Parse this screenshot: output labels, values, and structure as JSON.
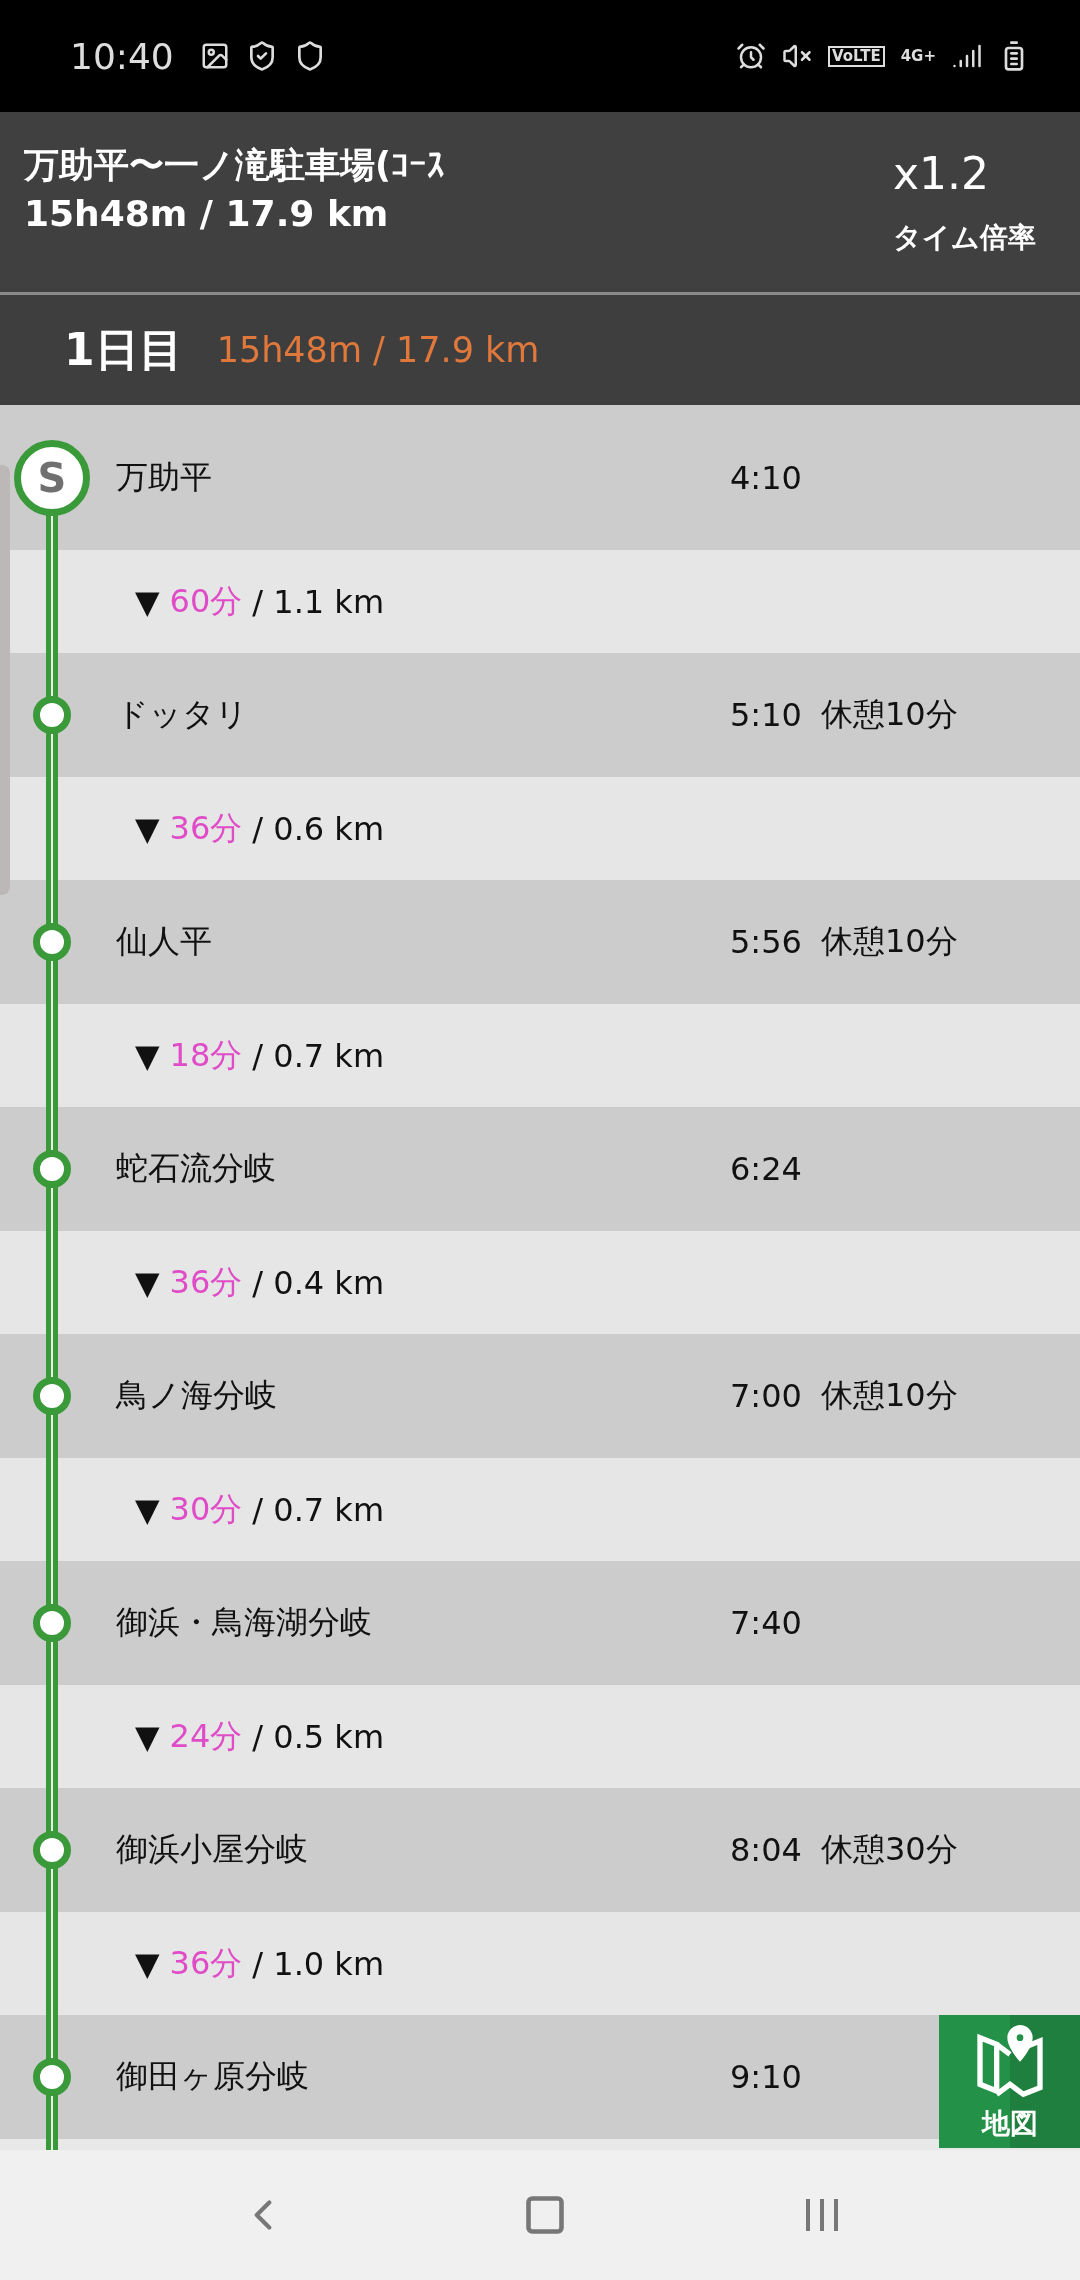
{
  "status_bar": {
    "time": "10:40",
    "volte": "VoLTE",
    "network": "4G+"
  },
  "header": {
    "title": "万助平〜一ノ滝駐車場(ｺｰｽ",
    "summary": "15h48m / 17.9 km",
    "multiplier": "x1.2",
    "multiplier_label": "タイム倍率"
  },
  "day": {
    "label": "1日目",
    "summary": "15h48m / 17.9 km"
  },
  "route": [
    {
      "kind": "start",
      "marker": "S",
      "name": "万助平",
      "time": "4:10"
    },
    {
      "kind": "segment",
      "arrow": "▼",
      "duration": "60分",
      "distance": "/ 1.1 km"
    },
    {
      "kind": "point",
      "name": "ドッタリ",
      "time": "5:10",
      "rest": "休憩10分"
    },
    {
      "kind": "segment",
      "arrow": "▼",
      "duration": "36分",
      "distance": "/ 0.6 km"
    },
    {
      "kind": "point",
      "name": "仙人平",
      "time": "5:56",
      "rest": "休憩10分"
    },
    {
      "kind": "segment",
      "arrow": "▼",
      "duration": "18分",
      "distance": "/ 0.7 km"
    },
    {
      "kind": "point",
      "name": "蛇石流分岐",
      "time": "6:24"
    },
    {
      "kind": "segment",
      "arrow": "▼",
      "duration": "36分",
      "distance": "/ 0.4 km"
    },
    {
      "kind": "point",
      "name": "鳥ノ海分岐",
      "time": "7:00",
      "rest": "休憩10分"
    },
    {
      "kind": "segment",
      "arrow": "▼",
      "duration": "30分",
      "distance": "/ 0.7 km"
    },
    {
      "kind": "point",
      "name": "御浜・鳥海湖分岐",
      "time": "7:40"
    },
    {
      "kind": "segment",
      "arrow": "▼",
      "duration": "24分",
      "distance": "/ 0.5 km"
    },
    {
      "kind": "point",
      "name": "御浜小屋分岐",
      "time": "8:04",
      "rest": "休憩30分"
    },
    {
      "kind": "segment",
      "arrow": "▼",
      "duration": "36分",
      "distance": "/ 1.0 km"
    },
    {
      "kind": "point",
      "name": "御田ヶ原分岐",
      "time": "9:10"
    }
  ],
  "map_button": {
    "label": "地図"
  }
}
